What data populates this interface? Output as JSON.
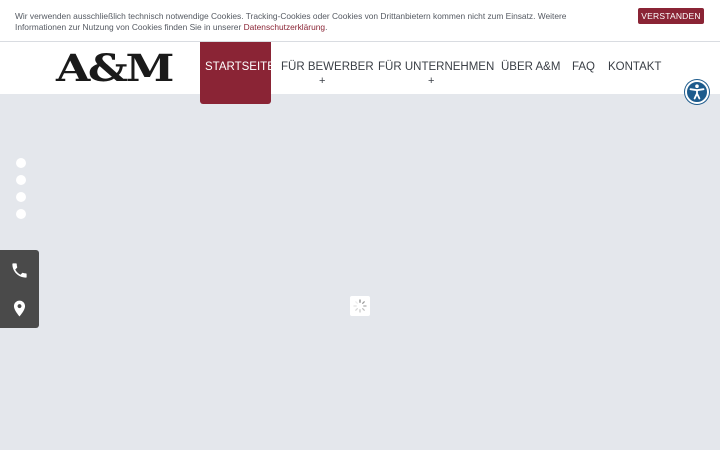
{
  "cookie_notice": {
    "text_before_link": "Wir verwenden ausschließlich technisch notwendige Cookies. Tracking-Cookies oder Cookies von Drittanbietern kommen nicht zum Einsatz. Weitere Informationen zur Nutzung von Cookies finden Sie in unserer ",
    "link_text": "Datenschutzerklärung",
    "text_after_link": ".",
    "accept_label": "VERSTANDEN"
  },
  "brand": {
    "logo_text": "A&M"
  },
  "nav": {
    "items": [
      {
        "label": "STARTSEITE",
        "active": true,
        "has_submenu": false
      },
      {
        "label": "FÜR BEWERBER",
        "active": false,
        "has_submenu": true
      },
      {
        "label": "FÜR UNTERNEHMEN",
        "active": false,
        "has_submenu": true
      },
      {
        "label": "ÜBER A&M",
        "active": false,
        "has_submenu": false
      },
      {
        "label": "FAQ",
        "active": false,
        "has_submenu": false
      },
      {
        "label": "KONTAKT",
        "active": false,
        "has_submenu": false
      }
    ],
    "submenu_marker": "+"
  },
  "slider": {
    "slide_count": 4
  },
  "side_contact": {
    "icons": [
      "phone-icon",
      "location-pin-icon"
    ]
  },
  "colors": {
    "brand": "#8a2435",
    "accessibility": "#1d5b8c",
    "side_panel": "#4a4a4a",
    "background": "#e4e7ec"
  }
}
